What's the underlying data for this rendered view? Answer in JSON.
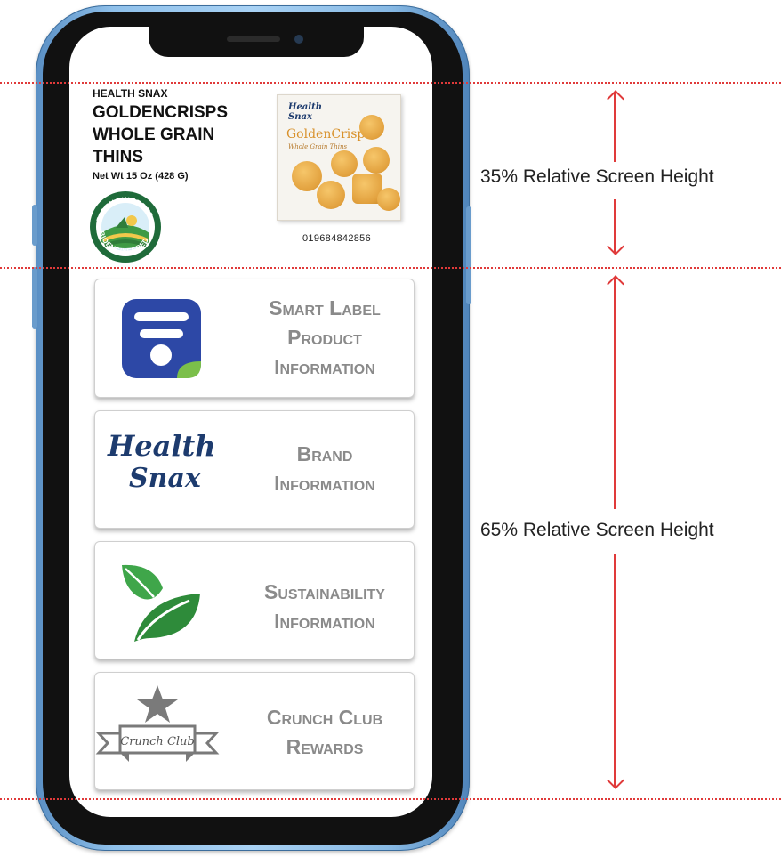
{
  "product": {
    "brand_small": "HEALTH SNAX",
    "name_line1": "GOLDENCRISPS",
    "name_line2": "WHOLE GRAIN",
    "name_line3": "THINS",
    "net_weight": "Net Wt 15 Oz (428 G)",
    "badge_text": "BIOENGINEERED",
    "barcode": "019684842856",
    "box": {
      "brand_line1": "Health",
      "brand_line2": "Snax",
      "title": "GoldenCrisps",
      "subtitle": "Whole Grain Thins"
    }
  },
  "cards": [
    {
      "icon": "smart-label-icon",
      "line1": "Smart Label",
      "line2": "Product",
      "line3": "Information"
    },
    {
      "icon": "health-snax-logo",
      "logo_line1": "Health",
      "logo_line2": "Snax",
      "line1": "Brand",
      "line2": "Information"
    },
    {
      "icon": "leaf-icon",
      "line1": "Sustainability",
      "line2": "Information"
    },
    {
      "icon": "crunch-club-icon",
      "logo_text": "Crunch Club",
      "line1": "Crunch Club",
      "line2": "Rewards"
    }
  ],
  "annotations": {
    "top_label": "35% Relative Screen Height",
    "bottom_label": "65% Relative Screen Height"
  },
  "colors": {
    "guide_red": "#e03a3a",
    "smart_label_blue": "#2d48a6",
    "leaf_green": "#2e8b3a",
    "brand_navy": "#1d3b6e",
    "card_text_gray": "#8a8a8a"
  }
}
